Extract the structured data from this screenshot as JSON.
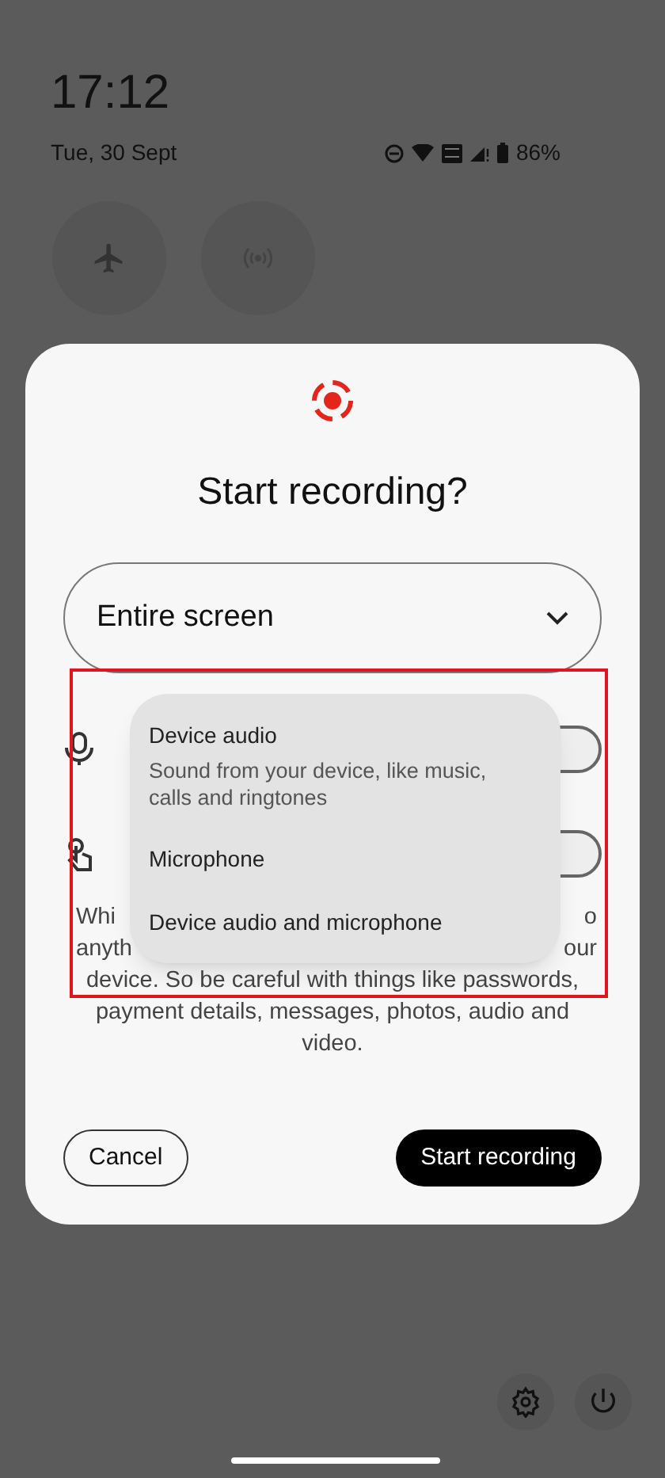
{
  "status_bar": {
    "time": "17:12",
    "date": "Tue, 30 Sept",
    "battery": "86%"
  },
  "dialog": {
    "title": "Start recording?",
    "source": {
      "value": "Entire screen"
    },
    "toggles": [
      {
        "kind": "microphone",
        "on": false
      },
      {
        "kind": "touches",
        "on": false
      }
    ],
    "notice_lines": [
      {
        "left": "Whi",
        "right": "o"
      },
      {
        "left": "anyth",
        "right": "our"
      },
      {
        "left": "device. So be careful with things like passwords,"
      },
      {
        "left": "payment details, messages, photos, audio and"
      },
      {
        "left": "video."
      }
    ],
    "buttons": {
      "cancel": "Cancel",
      "start": "Start recording"
    }
  },
  "audio_menu": [
    {
      "label": "Device audio",
      "description": "Sound from your device, like music, calls and ringtones"
    },
    {
      "label": "Microphone"
    },
    {
      "label": "Device audio and microphone"
    }
  ]
}
